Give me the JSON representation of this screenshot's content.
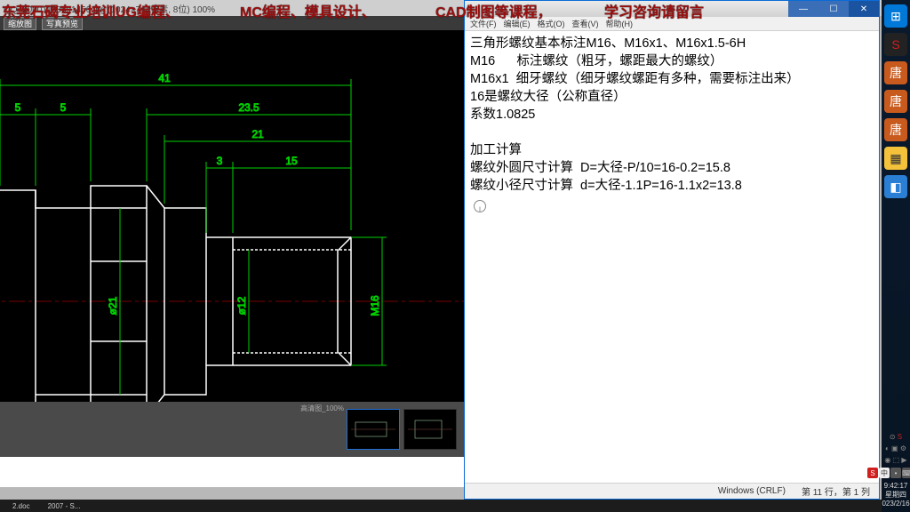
{
  "banner": {
    "seg1": "东莞石碣专业培训UG编程、",
    "seg2": "MC编程、模具设计、",
    "seg3": "CAD制图等课程，",
    "seg4": "学习咨询请留言"
  },
  "viewer": {
    "title_left": "QQ_20001138691456.jpg  (1024×744像素, 8位) 100%",
    "tb_btn1": "缩放图",
    "tb_btn2": "写真预览",
    "thumb_label": "高清图_100%"
  },
  "cad": {
    "dim_41": "41",
    "dim_5a": "5",
    "dim_5b": "5",
    "dim_23_5": "23.5",
    "dim_21": "21",
    "dim_3": "3",
    "dim_15": "15",
    "dia_21": "ø21",
    "dia_12": "ø12",
    "thread_m16": "M16"
  },
  "notes": {
    "l1": "三角形螺纹基本标注M16、M16x1、M16x1.5-6H",
    "l2": "M16      标注螺纹（粗牙，螺距最大的螺纹）",
    "l3": "M16x1  细牙螺纹（细牙螺纹螺距有多种，需要标注出来）",
    "l4": "16是螺纹大径（公称直径）",
    "l5": "系数1.0825",
    "l6": "",
    "l7": "加工计算",
    "l8": "螺纹外圆尺寸计算  D=大径-P/10=16-0.2=15.8",
    "l9": "螺纹小径尺寸计算  d=大径-1.1P=16-1.1x2=13.8"
  },
  "notepad": {
    "menu_file": "文件(F)",
    "menu_edit": "编辑(E)",
    "menu_format": "格式(O)",
    "menu_view": "查看(V)",
    "menu_help": "帮助(H)",
    "status_encoding": "Windows (CRLF)",
    "status_pos": "第 11 行，第 1 列"
  },
  "taskbar": {
    "item1": "2.doc",
    "item2": "2007 - S..."
  },
  "sidebar": {
    "char": "唐"
  },
  "clock": {
    "time": "9:42:17",
    "date_label": "星期四",
    "date": "023/2/16"
  },
  "ime": {
    "s": "S",
    "zh": "中"
  }
}
